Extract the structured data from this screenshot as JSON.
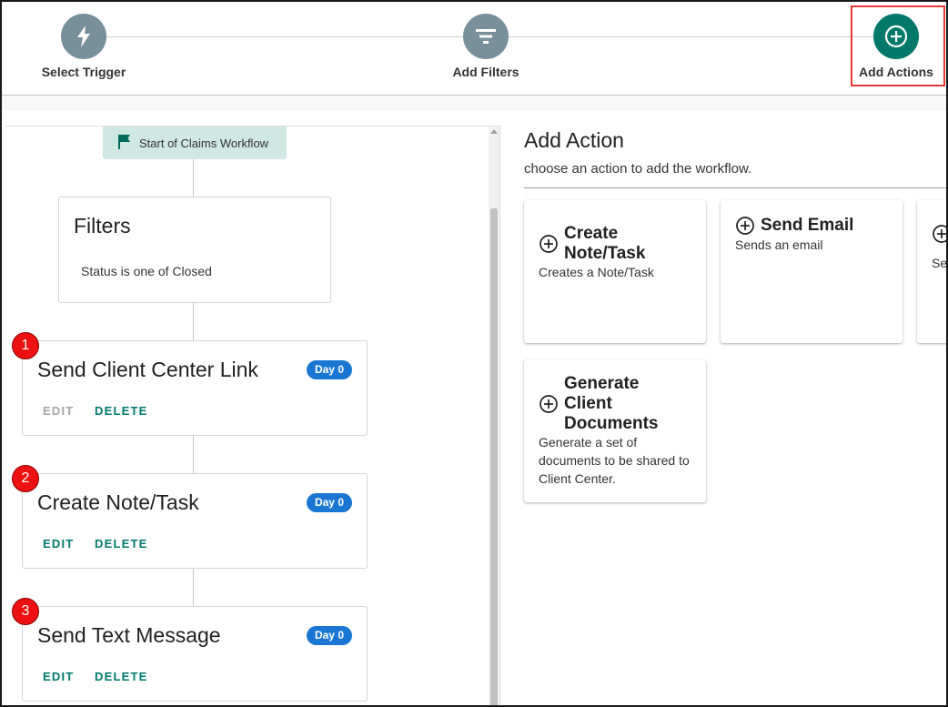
{
  "stepper": {
    "steps": [
      {
        "label": "Select Trigger",
        "icon": "lightning-bolt-icon",
        "state": "inactive"
      },
      {
        "label": "Add Filters",
        "icon": "filter-icon",
        "state": "inactive"
      },
      {
        "label": "Add Actions",
        "icon": "add-circle-icon",
        "state": "active"
      }
    ]
  },
  "workflow": {
    "start_label": "Start of Claims Workflow",
    "filters": {
      "title": "Filters",
      "condition": "Status is one of Closed"
    },
    "actions": [
      {
        "number": "1",
        "title": "Send Client Center Link",
        "day": "Day 0",
        "edit": "EDIT",
        "delete": "DELETE",
        "edit_disabled": true
      },
      {
        "number": "2",
        "title": "Create Note/Task",
        "day": "Day 0",
        "edit": "EDIT",
        "delete": "DELETE",
        "edit_disabled": false
      },
      {
        "number": "3",
        "title": "Send Text Message",
        "day": "Day 0",
        "edit": "EDIT",
        "delete": "DELETE",
        "edit_disabled": false
      }
    ]
  },
  "panel": {
    "title": "Add Action",
    "subtitle": "choose an action to add the workflow.",
    "options": [
      {
        "title_line1": "Create",
        "title_line2": "Note/Task",
        "title_line3": "",
        "description": "Creates a Note/Task"
      },
      {
        "title_line1": "Send Email",
        "description": "Sends an email"
      },
      {
        "description_partial": "Se"
      },
      {
        "title_line1": "Generate",
        "title_line2": "Client",
        "title_line3": "Documents",
        "description": "Generate a set of documents to be shared to Client Center."
      }
    ]
  },
  "colors": {
    "accent": "#00796b",
    "inactive_step": "#78909c",
    "chip": "#1976d2",
    "badge": "#ee1111",
    "highlight": "#e53935",
    "start_node": "#cfe8e2"
  }
}
